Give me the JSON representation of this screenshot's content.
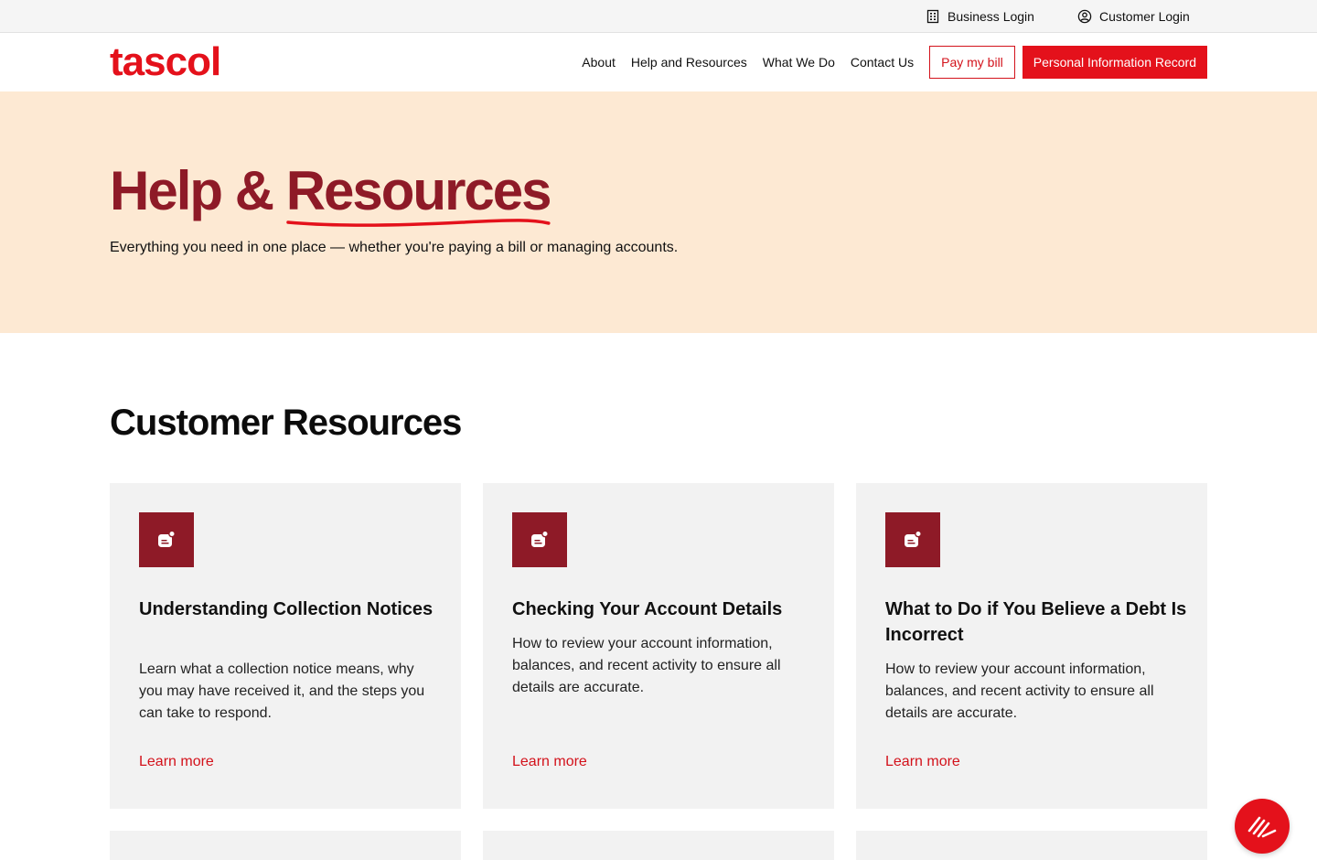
{
  "topbar": {
    "business_login": "Business Login",
    "customer_login": "Customer Login"
  },
  "brand": {
    "logo_text": "tascol",
    "accent_color": "#e4111b",
    "dark_red": "#8e1a27"
  },
  "nav": {
    "items": [
      "About",
      "Help and Resources",
      "What We Do",
      "Contact Us"
    ],
    "pay_bill": "Pay my bill",
    "personal_info": "Personal Information Record"
  },
  "hero": {
    "title_part1": "Help & ",
    "title_part2": "Resources",
    "subtitle": "Everything you need in one place — whether you're paying a bill or managing accounts."
  },
  "section": {
    "title": "Customer Resources"
  },
  "cards": [
    {
      "icon": "notification-icon",
      "title": "Understanding Collection Notices",
      "description": "Learn what a collection notice means, why you may have received it, and the steps you can take to respond.",
      "link": "Learn more"
    },
    {
      "icon": "notification-icon",
      "title": "Checking Your Account Details",
      "description": "How to review your account information, balances, and recent activity to ensure all details are accurate.",
      "link": "Learn more"
    },
    {
      "icon": "notification-icon",
      "title": "What to Do if You Believe a Debt Is Incorrect",
      "description": "How to review your account information, balances, and recent activity to ensure all details are accurate.",
      "link": "Learn more"
    }
  ],
  "chat": {
    "icon": "chat-launcher-icon"
  }
}
